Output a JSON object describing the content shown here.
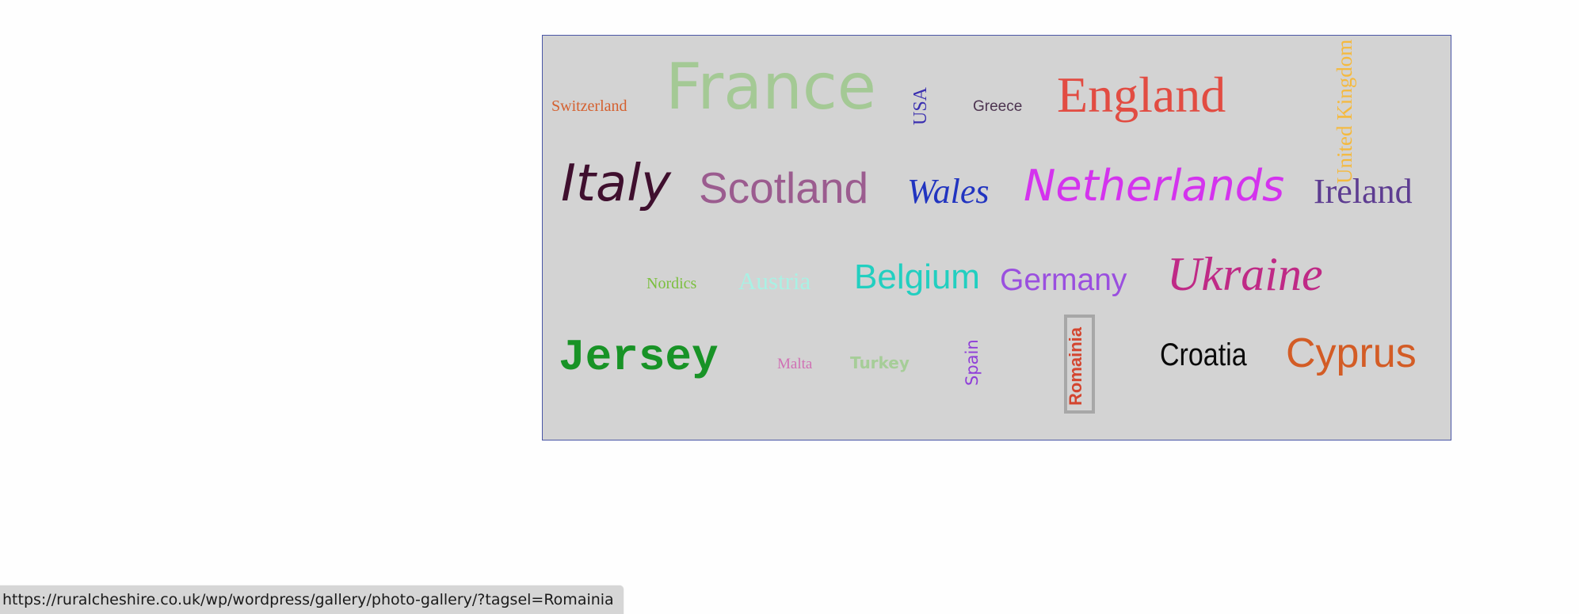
{
  "tag_cloud": {
    "tags": [
      {
        "label": "Switzerland",
        "color": "#d4602f"
      },
      {
        "label": "France",
        "color": "#a4c995"
      },
      {
        "label": "USA",
        "color": "#3a2fb0"
      },
      {
        "label": "Greece",
        "color": "#4d3450"
      },
      {
        "label": "England",
        "color": "#e24c42"
      },
      {
        "label": "United Kingdom",
        "color": "#f5b93d"
      },
      {
        "label": "Italy",
        "color": "#3f0f2e"
      },
      {
        "label": "Scotland",
        "color": "#9b5c8f"
      },
      {
        "label": "Wales",
        "color": "#2134c0"
      },
      {
        "label": "Netherlands",
        "color": "#d433ee"
      },
      {
        "label": "Ireland",
        "color": "#5d3c91"
      },
      {
        "label": "Nordics",
        "color": "#7bbf3e"
      },
      {
        "label": "Austria",
        "color": "#a9f1e4"
      },
      {
        "label": "Belgium",
        "color": "#22cfc0"
      },
      {
        "label": "Germany",
        "color": "#9a4fdf"
      },
      {
        "label": "Ukraine",
        "color": "#bf2a86"
      },
      {
        "label": "Jersey",
        "color": "#189326"
      },
      {
        "label": "Malta",
        "color": "#d070b4"
      },
      {
        "label": "Turkey",
        "color": "#a6cd98"
      },
      {
        "label": "Spain",
        "color": "#8f3ed8"
      },
      {
        "label": "Romainia",
        "color": "#d4452f"
      },
      {
        "label": "Croatia",
        "color": "#0a0a0a"
      },
      {
        "label": "Cyprus",
        "color": "#d35c25"
      }
    ],
    "hovered_tag": "Romainia"
  },
  "status_bar": {
    "url": "https://ruralcheshire.co.uk/wp/wordpress/gallery/photo-gallery/?tagsel=Romainia"
  }
}
